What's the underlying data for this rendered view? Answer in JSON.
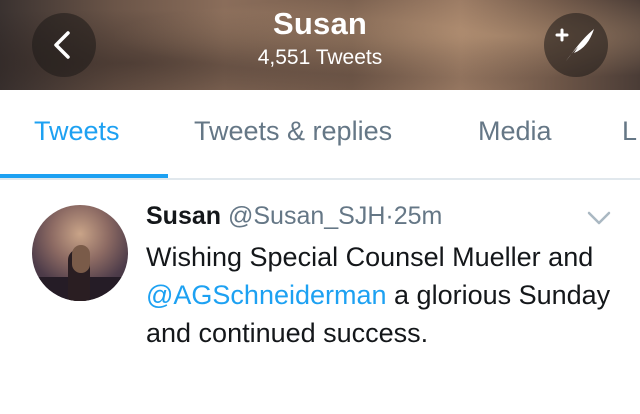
{
  "header": {
    "title": "Susan",
    "subtitle": "4,551 Tweets",
    "back_icon": "chevron-left-icon",
    "compose_icon": "compose-quill-icon"
  },
  "tabs": [
    {
      "label": "Tweets",
      "active": true
    },
    {
      "label": "Tweets & replies",
      "active": false
    },
    {
      "label": "Media",
      "active": false
    },
    {
      "label": "L",
      "active": false
    }
  ],
  "tweet": {
    "name": "Susan",
    "handle": "@Susan_SJH",
    "separator": "·",
    "time": "25m",
    "text_part1": "Wishing Special Counsel Mueller and ",
    "mention": "@AGSchneiderman",
    "text_part2": " a glorious Sunday and continued success."
  },
  "colors": {
    "accent": "#1da1f2",
    "secondary_text": "#657786",
    "primary_text": "#14171a"
  }
}
